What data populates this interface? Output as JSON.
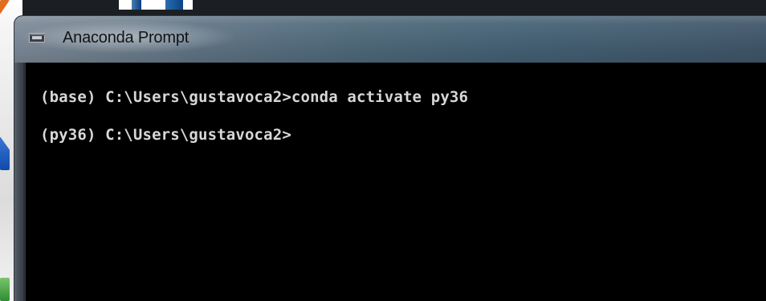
{
  "window": {
    "title": "Anaconda Prompt",
    "icon": "console-icon"
  },
  "console": {
    "lines": [
      "(base) C:\\Users\\gustavoca2>conda activate py36",
      "(py36) C:\\Users\\gustavoca2>"
    ]
  },
  "colors": {
    "console_background": "#000000",
    "console_text": "#d7d7d7",
    "title_text": "#101418"
  }
}
